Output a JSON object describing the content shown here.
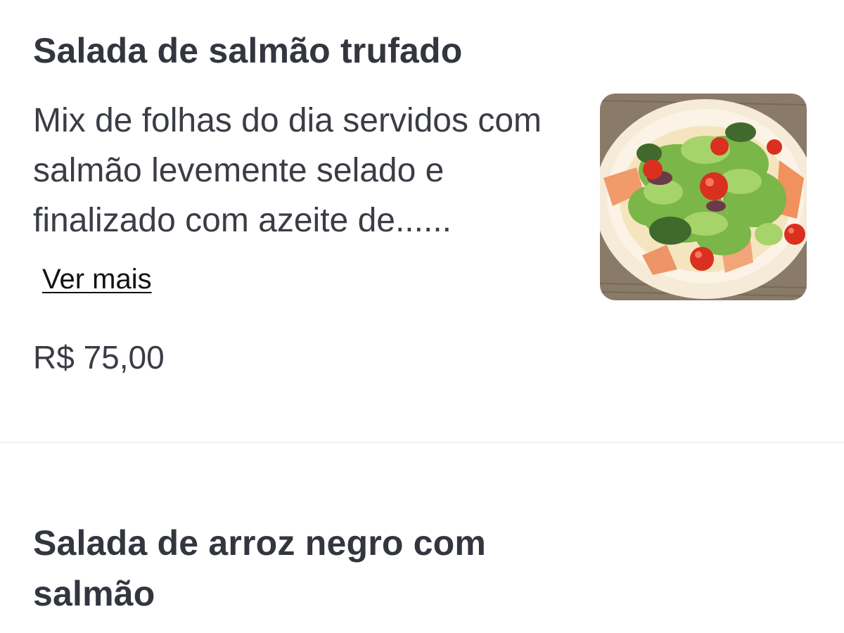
{
  "menu": {
    "items": [
      {
        "title": "Salada de salmão trufado",
        "description": "Mix de folhas do dia servidos com salmão levemente selado e finalizado com azeite de......",
        "see_more": "Ver mais",
        "price": "R$ 75,00",
        "image_icon": "salad-bowl-photo"
      },
      {
        "title": "Salada de arroz negro com salmão"
      }
    ]
  },
  "colors": {
    "text_primary": "#33363f",
    "link": "#111111",
    "divider": "#f1f1f3",
    "background": "#ffffff"
  }
}
